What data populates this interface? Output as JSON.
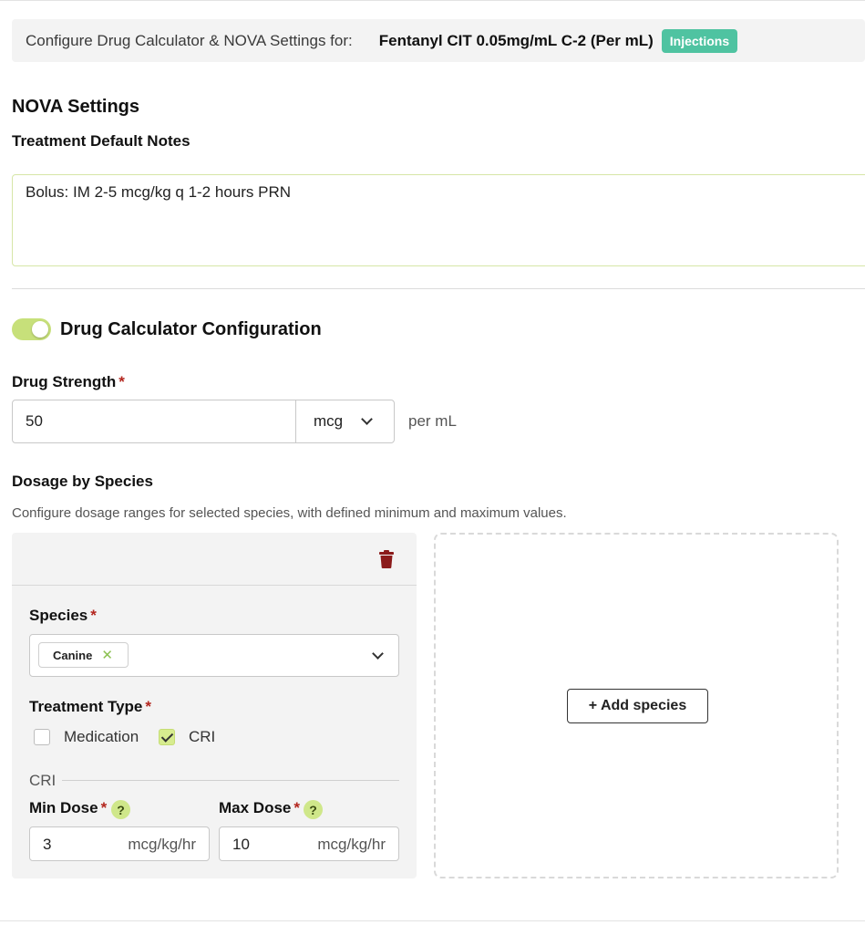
{
  "header": {
    "prefix": "Configure Drug Calculator & NOVA Settings for:",
    "drug_name": "Fentanyl CIT 0.05mg/mL C-2 (Per mL)",
    "badge": "Injections"
  },
  "nova": {
    "title": "NOVA Settings",
    "notes_label": "Treatment Default Notes",
    "notes_value": "Bolus: IM 2-5 mcg/kg q 1-2 hours PRN"
  },
  "calculator": {
    "title": "Drug Calculator Configuration",
    "enabled": true,
    "strength_label": "Drug Strength",
    "required_mark": "*",
    "strength_value": "50",
    "strength_unit": "mcg",
    "per_unit": "per mL"
  },
  "dosage": {
    "title": "Dosage by Species",
    "description": "Configure dosage ranges for selected species, with defined minimum and maximum values.",
    "species_label": "Species",
    "species_selected": "Canine",
    "treatment_type_label": "Treatment Type",
    "medication_label": "Medication",
    "medication_checked": false,
    "cri_label": "CRI",
    "cri_checked": true,
    "cri_section_label": "CRI",
    "min_dose_label": "Min Dose",
    "max_dose_label": "Max Dose",
    "help_symbol": "?",
    "min_dose_value": "3",
    "max_dose_value": "10",
    "dose_unit": "mcg/kg/hr",
    "add_species_label": "+ Add species"
  },
  "colors": {
    "accent": "#c7e07a",
    "badge": "#4fc3a1",
    "delete": "#8b1a1a"
  }
}
